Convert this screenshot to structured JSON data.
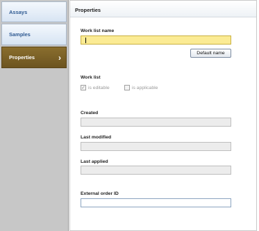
{
  "sidebar": {
    "items": [
      {
        "label": "Assays"
      },
      {
        "label": "Samples"
      },
      {
        "label": "Properties"
      }
    ]
  },
  "properties": {
    "header": "Properties",
    "work_list_name": {
      "label": "Work list name",
      "value": ""
    },
    "default_name_button": "Default name",
    "work_list": {
      "label": "Work list",
      "is_editable": {
        "label": "is editable",
        "checked": true
      },
      "is_applicable": {
        "label": "is applicable",
        "checked": false
      }
    },
    "created": {
      "label": "Created",
      "value": ""
    },
    "last_modified": {
      "label": "Last modified",
      "value": ""
    },
    "last_applied": {
      "label": "Last applied",
      "value": ""
    },
    "external_order_id": {
      "label": "External order ID",
      "value": ""
    }
  },
  "icons": {
    "active_nav": "chevron-right-icon",
    "check": "checkmark-icon"
  },
  "colors": {
    "active_nav": "#7d6227",
    "nav_text": "#2f5a92",
    "active_field": "#fbeb94"
  }
}
